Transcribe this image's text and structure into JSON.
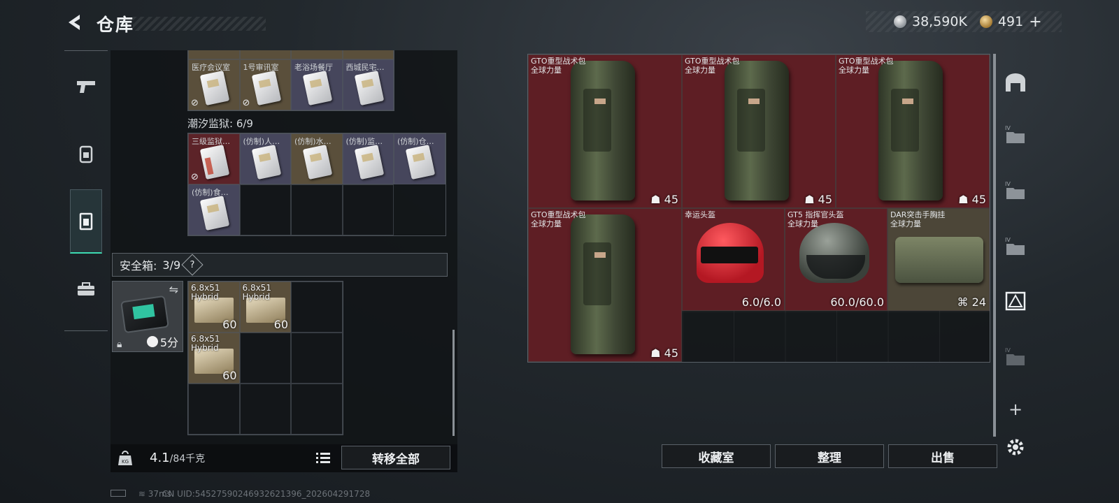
{
  "header": {
    "title": "仓库",
    "currency": {
      "coins": "38,590K",
      "premium": "491",
      "plus": "+"
    }
  },
  "left_nav": [
    "weapons-icon",
    "equipment-icon",
    "storage-icon",
    "toolbox-icon"
  ],
  "keycards_top": [
    {
      "label": "医疗会议室",
      "bg": "tan",
      "no_transfer": true
    },
    {
      "label": "1号审讯室",
      "bg": "tan",
      "no_transfer": true
    },
    {
      "label": "老浴场餐厅",
      "bg": "purple",
      "no_transfer": false
    },
    {
      "label": "西城民宅…",
      "bg": "purple",
      "no_transfer": false
    }
  ],
  "prison_section": {
    "label": "潮汐监狱: 6/9",
    "cards": [
      {
        "label": "三级监狱…",
        "bg": "red",
        "no_transfer": true
      },
      {
        "label": "(仿制)人…",
        "bg": "purple",
        "no_transfer": false
      },
      {
        "label": "(仿制)水…",
        "bg": "tan",
        "no_transfer": false
      },
      {
        "label": "(仿制)监…",
        "bg": "purple",
        "no_transfer": false
      },
      {
        "label": "(仿制)仓…",
        "bg": "purple",
        "no_transfer": false
      },
      {
        "label": "(仿制)食…",
        "bg": "purple",
        "no_transfer": false
      }
    ]
  },
  "safebox": {
    "label": "安全箱:",
    "count": "3/9",
    "help": "?",
    "timer": "5分",
    "ammo": [
      {
        "line1": "6.8x51",
        "line2": "Hybrid",
        "count": "60"
      },
      {
        "line1": "6.8x51",
        "line2": "Hybrid",
        "count": "60"
      },
      {
        "line1": "6.8x51",
        "line2": "Hybrid",
        "count": "60"
      }
    ]
  },
  "weight": {
    "current": "4.1",
    "max": "/84千克"
  },
  "transfer_all": "转移全部",
  "stash_items": [
    {
      "name": "GTO重型战术包",
      "sub": "全球力量",
      "stat": "45",
      "type": "backpack"
    },
    {
      "name": "GTO重型战术包",
      "sub": "全球力量",
      "stat": "45",
      "type": "backpack"
    },
    {
      "name": "GTO重型战术包",
      "sub": "全球力量",
      "stat": "45",
      "type": "backpack"
    },
    {
      "name": "GTO重型战术包",
      "sub": "全球力量",
      "stat": "45",
      "type": "backpack"
    },
    {
      "name": "幸运头盔",
      "sub": "",
      "stat": "6.0/6.0",
      "type": "helmet-red"
    },
    {
      "name": "GT5 指挥官头盔",
      "sub": "全球力量",
      "stat": "60.0/60.0",
      "type": "helmet-gray"
    },
    {
      "name": "DAR突击手胸挂",
      "sub": "全球力量",
      "stat": "24",
      "type": "vest"
    }
  ],
  "bottom_buttons": {
    "collection": "收藏室",
    "sort": "整理",
    "sell": "出售"
  },
  "footer": {
    "ping": "37ms",
    "uid": "CN UID:545275902469326213​96_202604291728"
  }
}
